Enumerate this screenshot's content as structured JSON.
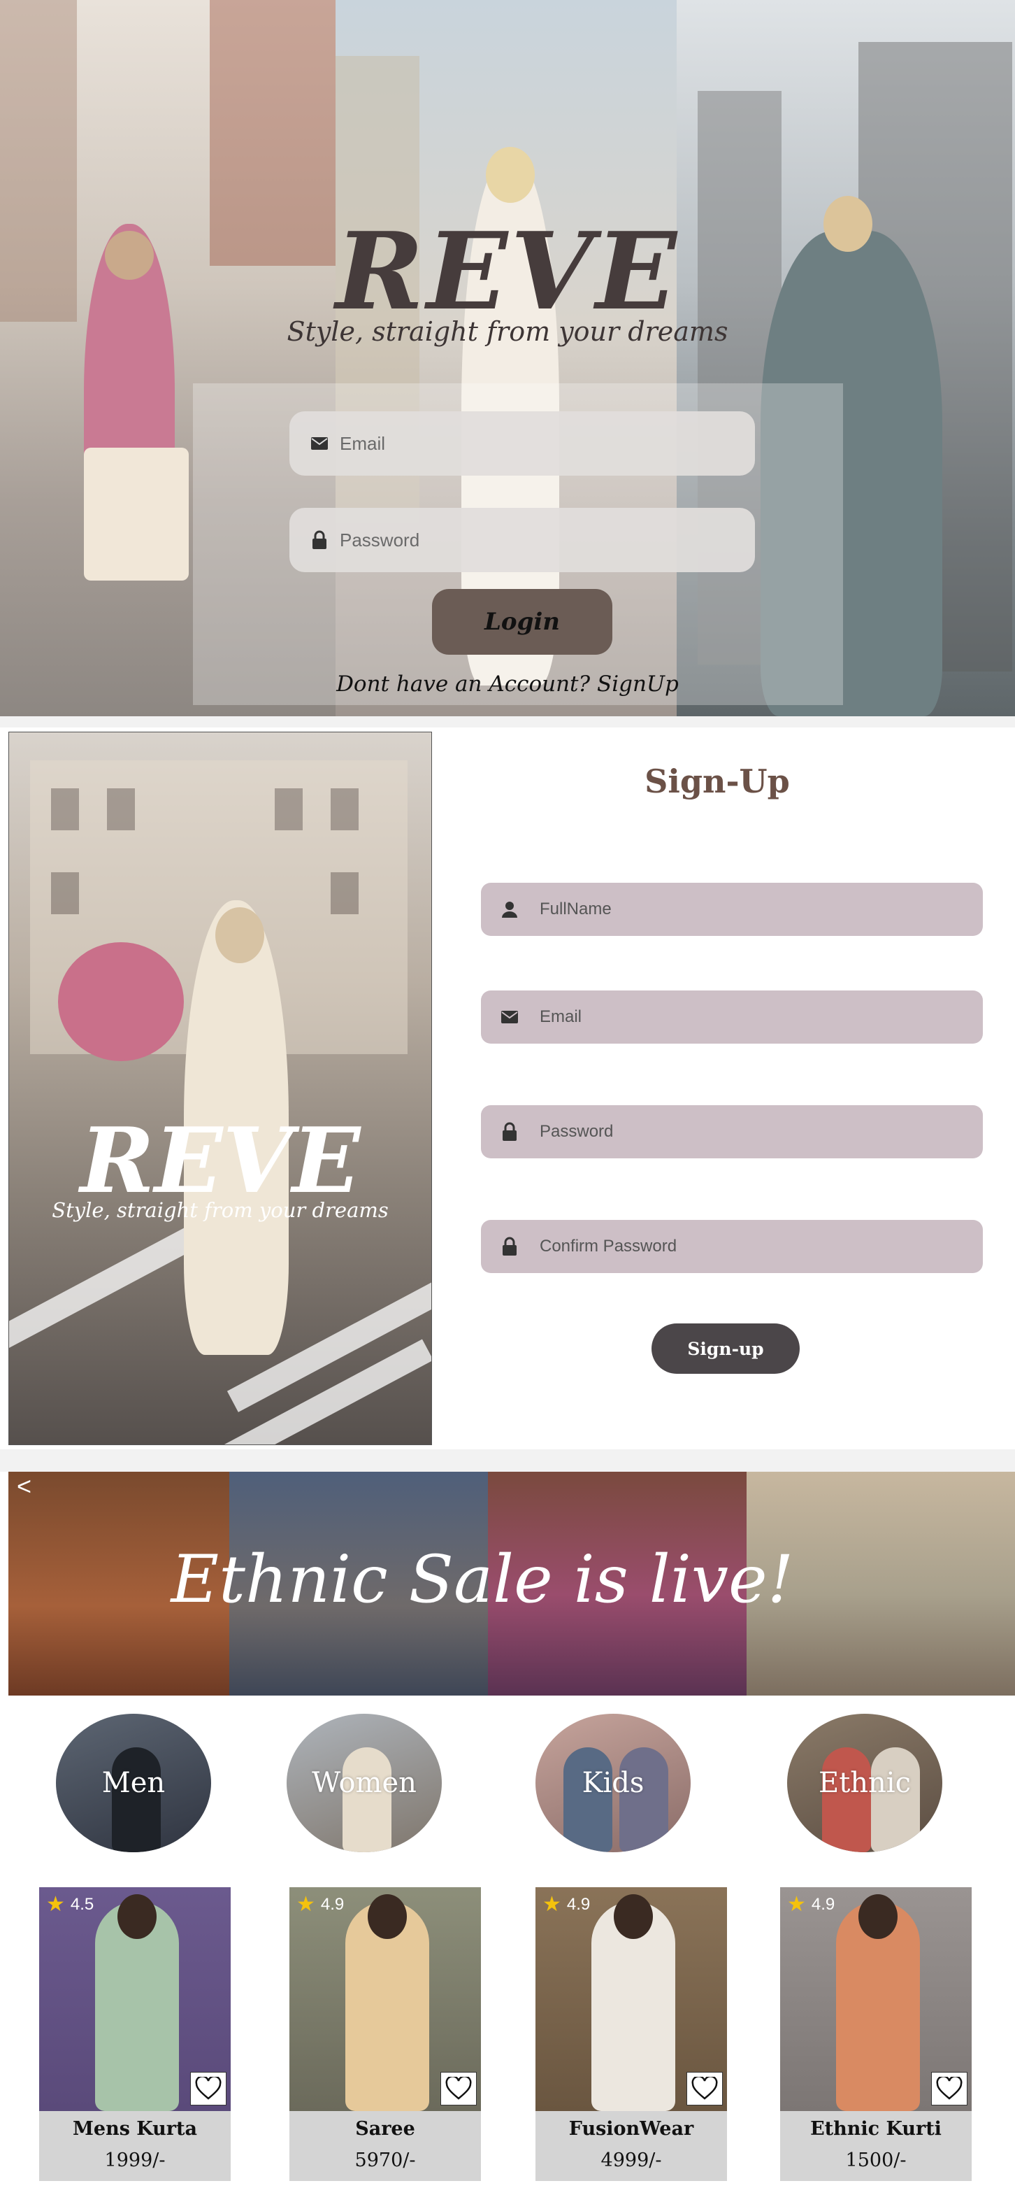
{
  "login": {
    "logo": "REVE",
    "tagline": "Style, straight from your dreams",
    "email_placeholder": "Email",
    "password_placeholder": "Password",
    "login_button": "Login",
    "signup_link": "Dont have an Account? SignUp"
  },
  "signup": {
    "logo": "REVE",
    "tagline": "Style, straight from your dreams",
    "title": "Sign-Up",
    "fullname_placeholder": "FullName",
    "email_placeholder": "Email",
    "password_placeholder": "Password",
    "confirm_placeholder": "Confirm Password",
    "button": "Sign-up"
  },
  "shop": {
    "banner_text": "Ethnic Sale is live!",
    "prev_glyph": "<",
    "categories": [
      "Men",
      "Women",
      "Kids",
      "Ethnic"
    ],
    "products": [
      {
        "name": "Mens Kurta",
        "price": "1999/-",
        "rating": "4.5"
      },
      {
        "name": "Saree",
        "price": "5970/-",
        "rating": "4.9"
      },
      {
        "name": "FusionWear",
        "price": "4999/-",
        "rating": "4.9"
      },
      {
        "name": "Ethnic Kurti",
        "price": "1500/-",
        "rating": "4.9"
      }
    ]
  },
  "colors": {
    "brand_dark": "#463c3c",
    "login_button": "#6b5c55",
    "signup_field": "#cdbfc6",
    "signup_button": "#4b4649",
    "signup_title": "#6b5147",
    "star": "#f4c20d"
  },
  "icons": [
    "mail-icon",
    "lock-icon",
    "user-icon",
    "chevron-left-icon",
    "star-icon",
    "heart-icon"
  ]
}
